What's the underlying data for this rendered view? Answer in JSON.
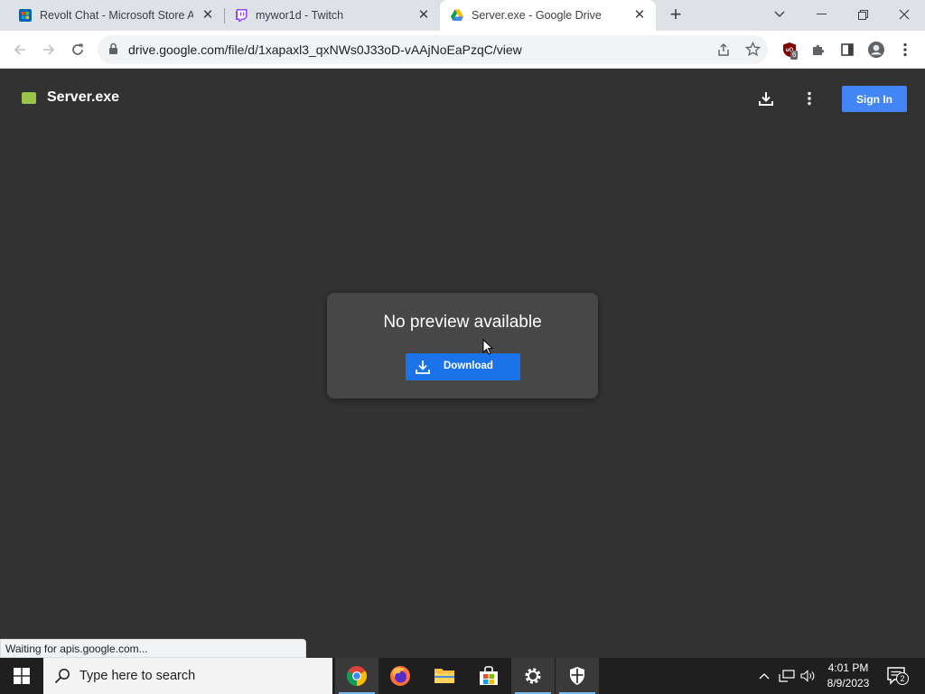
{
  "tabs": [
    {
      "title": "Revolt Chat - Microsoft Store Ap",
      "close": "✕"
    },
    {
      "title": "mywor1d - Twitch",
      "close": "✕"
    },
    {
      "title": "Server.exe - Google Drive",
      "close": "✕"
    }
  ],
  "browser": {
    "new_tab": "+",
    "url": "drive.google.com/file/d/1xapaxl3_qxNWs0J33oD-vAAjNoEaPzqC/view",
    "extension_badge": "6",
    "status": "Waiting for apis.google.com..."
  },
  "drive": {
    "file_name": "Server.exe",
    "sign_in": "Sign In",
    "no_preview": "No preview available",
    "download": "Download"
  },
  "taskbar": {
    "search_placeholder": "Type here to search",
    "time": "4:01 PM",
    "date": "8/9/2023",
    "notification_count": "2"
  },
  "colors": {
    "accent": "#1a73e8",
    "sign_in": "#4285f4",
    "page_bg": "#323232",
    "card_bg": "#474747"
  }
}
